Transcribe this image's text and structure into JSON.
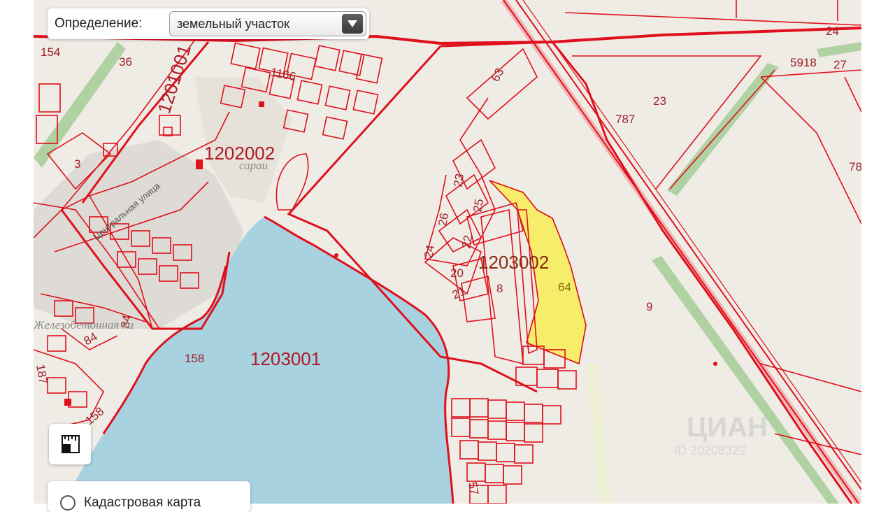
{
  "definition": {
    "label": "Определение:",
    "selected": "земельный участок"
  },
  "layers": {
    "label": "Кадастровая карта"
  },
  "quarters": [
    "1201001",
    "1202002",
    "1203002",
    "1203001"
  ],
  "plots": {
    "p154": "154",
    "p36": "36",
    "p1166": "1166",
    "p3": "3",
    "p63": "63",
    "p787": "787",
    "p23a": "23",
    "p24top": "24",
    "p5918": "5918",
    "p27": "27",
    "p78": "78",
    "p23b": "23",
    "p26": "26",
    "p25": "25",
    "p22": "22",
    "p24b": "24",
    "p20": "20",
    "p21": "21",
    "p8": "8",
    "p64": "64",
    "p9": "9",
    "p158a": "158",
    "p84a": "84",
    "p84b": "84",
    "p187": "187",
    "p158b": "158",
    "p57": "57"
  },
  "places": {
    "street": "Центральная улица",
    "sarai": "сараи",
    "lake": "Железобетонная ки"
  },
  "watermark": {
    "brand": "ЦИАН",
    "id": "ID 20208322"
  },
  "colors": {
    "boundary": "#e0101c",
    "highlight": "#f6ee6a",
    "water": "#a8d2e0",
    "background": "#efece6"
  }
}
